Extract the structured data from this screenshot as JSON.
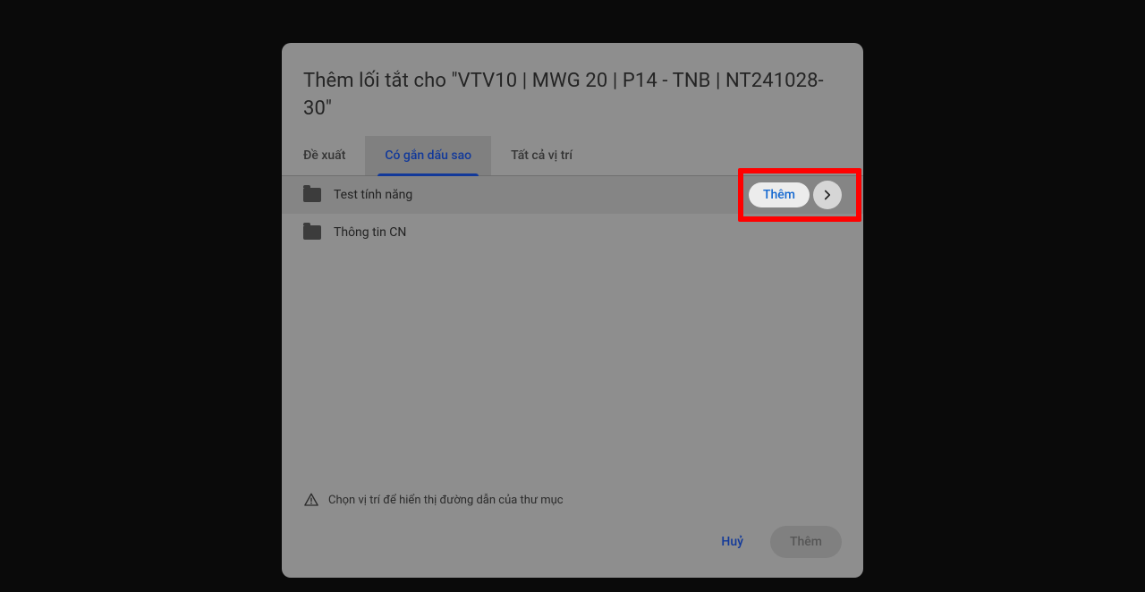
{
  "dialog": {
    "title": "Thêm lối tắt cho \"VTV10 | MWG 20 | P14 - TNB | NT241028-30\""
  },
  "tabs": [
    {
      "label": "Đề xuất",
      "active": false
    },
    {
      "label": "Có gắn dấu sao",
      "active": true
    },
    {
      "label": "Tất cả vị trí",
      "active": false
    }
  ],
  "folders": [
    {
      "name": "Test tính năng",
      "hovered": true
    },
    {
      "name": "Thông tin CN",
      "hovered": false
    }
  ],
  "row_action": {
    "add_label": "Thêm"
  },
  "hint": "Chọn vị trí để hiển thị đường dẫn của thư mục",
  "footer": {
    "cancel": "Huỷ",
    "confirm": "Thêm"
  }
}
